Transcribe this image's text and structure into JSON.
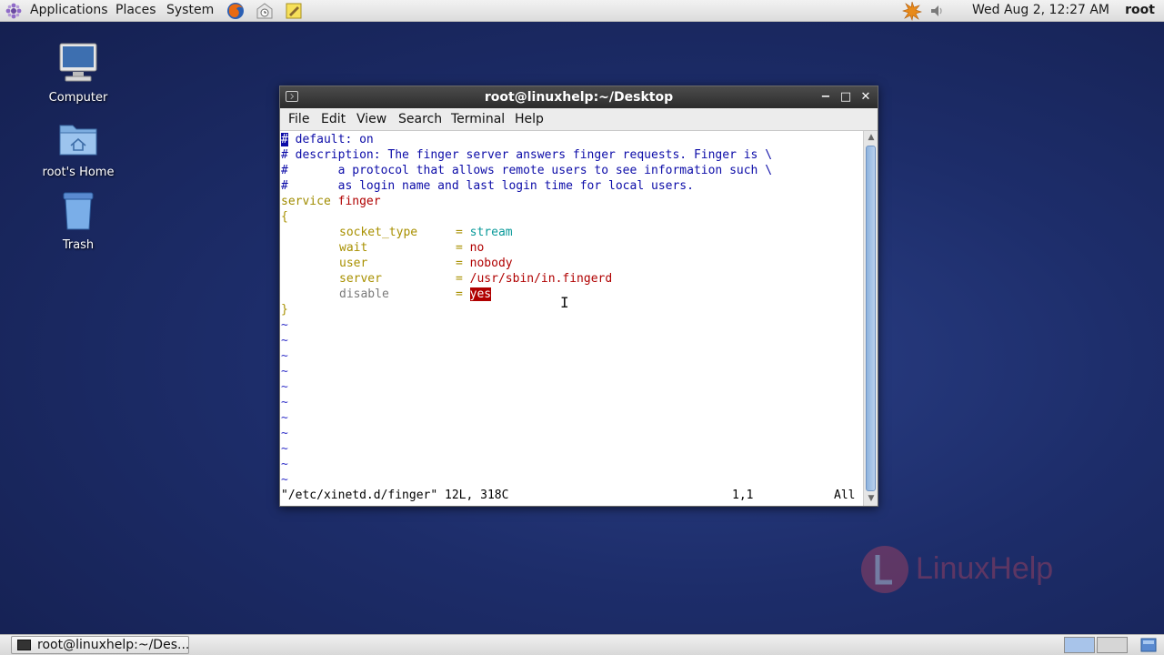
{
  "top_panel": {
    "menus": [
      "Applications",
      "Places",
      "System"
    ],
    "clock": "Wed Aug  2, 12:27 AM",
    "user": "root"
  },
  "desktop_icons": [
    {
      "label": "Computer",
      "icon": "computer-icon"
    },
    {
      "label": "root's Home",
      "icon": "home-folder-icon"
    },
    {
      "label": "Trash",
      "icon": "trash-icon"
    }
  ],
  "terminal": {
    "title": "root@linuxhelp:~/Desktop",
    "menu": [
      "File",
      "Edit",
      "View",
      "Search",
      "Terminal",
      "Help"
    ],
    "lines": {
      "l1": "# default: on",
      "l2": "# description: The finger server answers finger requests. Finger is \\",
      "l3": "#       a protocol that allows remote users to see information such \\",
      "l4": "#       as login name and last login time for local users.",
      "l5_kw": "service",
      "l5_name": "finger",
      "l6": "{",
      "attrs": [
        {
          "key": "socket_type",
          "value": "stream"
        },
        {
          "key": "wait",
          "value": "no"
        },
        {
          "key": "user",
          "value": "nobody"
        },
        {
          "key": "server",
          "value": "/usr/sbin/in.fingerd"
        },
        {
          "key": "disable",
          "value": "yes"
        }
      ],
      "l12": "}",
      "tilde": "~"
    },
    "status": {
      "file": "\"/etc/xinetd.d/finger\" 12L, 318C",
      "position": "1,1",
      "scroll": "All"
    }
  },
  "taskbar": {
    "window_label": "root@linuxhelp:~/Des..."
  },
  "watermark": {
    "text": "LinuxHelp"
  },
  "colors": {
    "comment": "#0c0ca8",
    "keyword": "#a08c00",
    "value": "#b00000",
    "type": "#0a9a9a"
  }
}
